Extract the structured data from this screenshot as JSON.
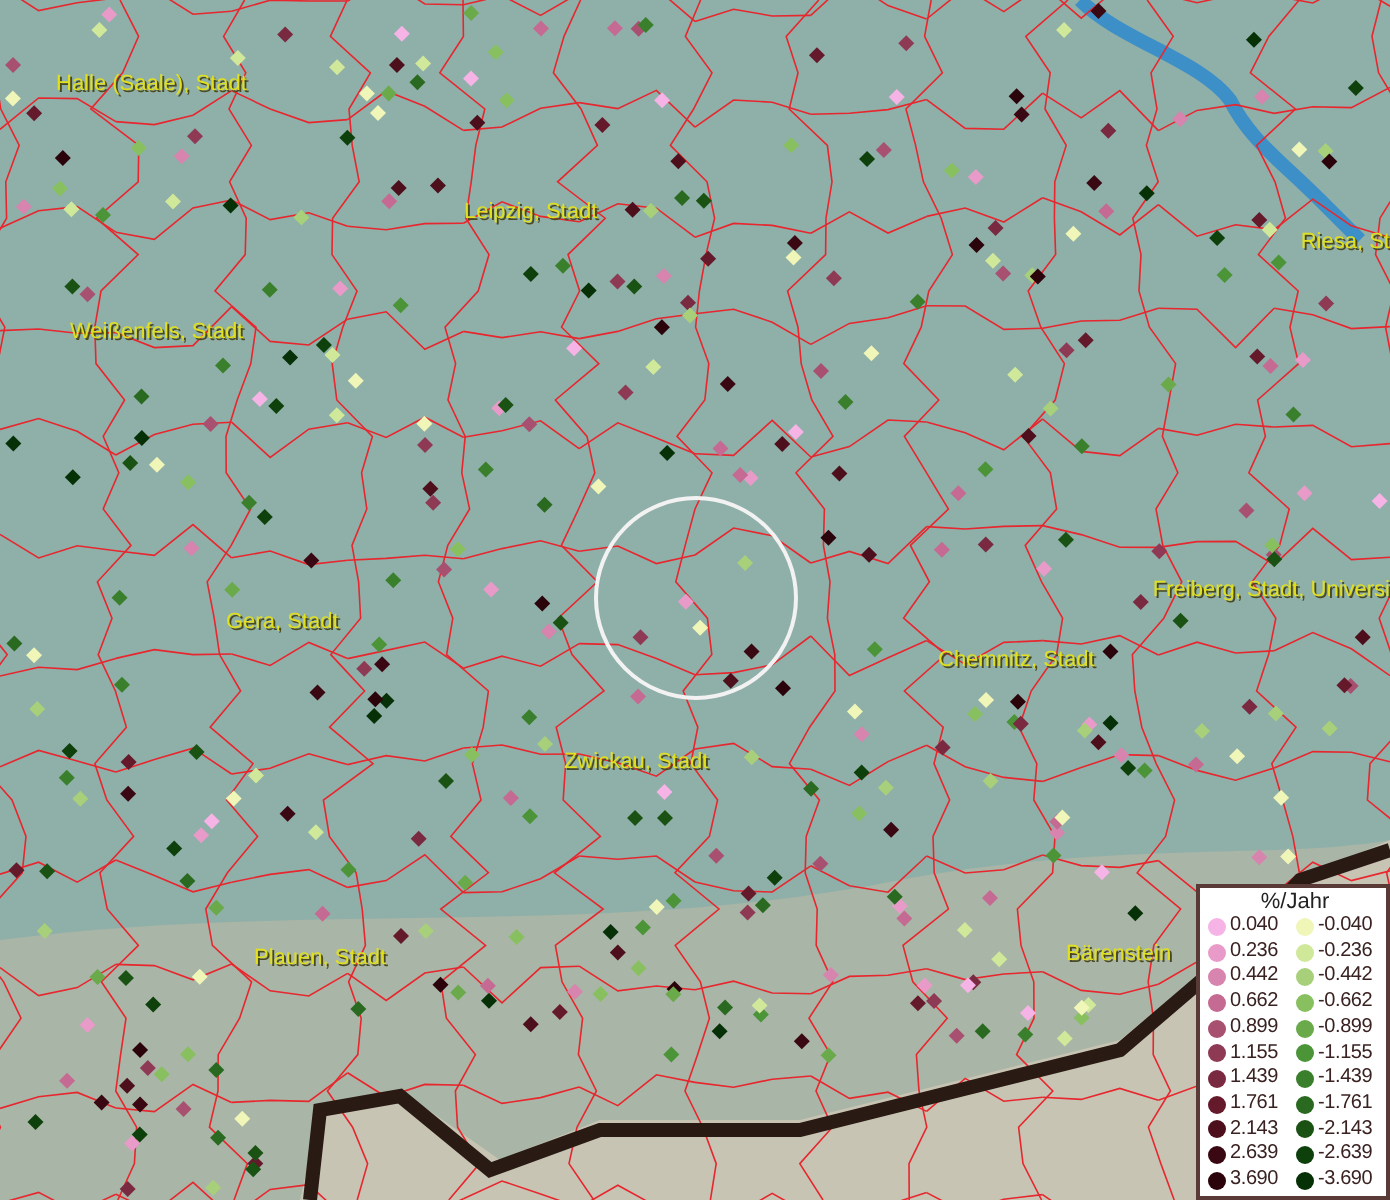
{
  "map": {
    "places": [
      {
        "name": "Halle (Saale), Stadt"
      },
      {
        "name": "Leipzig, Stadt"
      },
      {
        "name": "Riesa, St"
      },
      {
        "name": "Weißenfels, Stadt"
      },
      {
        "name": "Gera, Stadt"
      },
      {
        "name": "Freiberg, Stadt, Universi"
      },
      {
        "name": "Chemnitz, Stadt"
      },
      {
        "name": "Zwickau, Stadt"
      },
      {
        "name": "Plauen, Stadt"
      },
      {
        "name": "Bärenstein"
      }
    ]
  },
  "legend": {
    "title": "%/Jahr",
    "positive": [
      {
        "label": "0.040",
        "color": "#f5b3e6"
      },
      {
        "label": "0.236",
        "color": "#e89bc8"
      },
      {
        "label": "0.442",
        "color": "#d784ae"
      },
      {
        "label": "0.662",
        "color": "#c56a92"
      },
      {
        "label": "0.899",
        "color": "#a85070"
      },
      {
        "label": "1.155",
        "color": "#8f3a55"
      },
      {
        "label": "1.439",
        "color": "#7a2a40"
      },
      {
        "label": "1.761",
        "color": "#651a2c"
      },
      {
        "label": "2.143",
        "color": "#4d0f1c"
      },
      {
        "label": "2.639",
        "color": "#3a0812"
      },
      {
        "label": "3.690",
        "color": "#2a040a"
      }
    ],
    "negative": [
      {
        "label": "-0.040",
        "color": "#f0f5b8"
      },
      {
        "label": "-0.236",
        "color": "#d0e89a"
      },
      {
        "label": "-0.442",
        "color": "#a8d07a"
      },
      {
        "label": "-0.662",
        "color": "#88c060"
      },
      {
        "label": "-0.899",
        "color": "#6aaa4a"
      },
      {
        "label": "-1.155",
        "color": "#4c9438"
      },
      {
        "label": "-1.439",
        "color": "#3a802c"
      },
      {
        "label": "-1.761",
        "color": "#2a6a20"
      },
      {
        "label": "-2.143",
        "color": "#1a5214"
      },
      {
        "label": "-2.639",
        "color": "#0e400c"
      },
      {
        "label": "-3.690",
        "color": "#063006"
      }
    ]
  }
}
